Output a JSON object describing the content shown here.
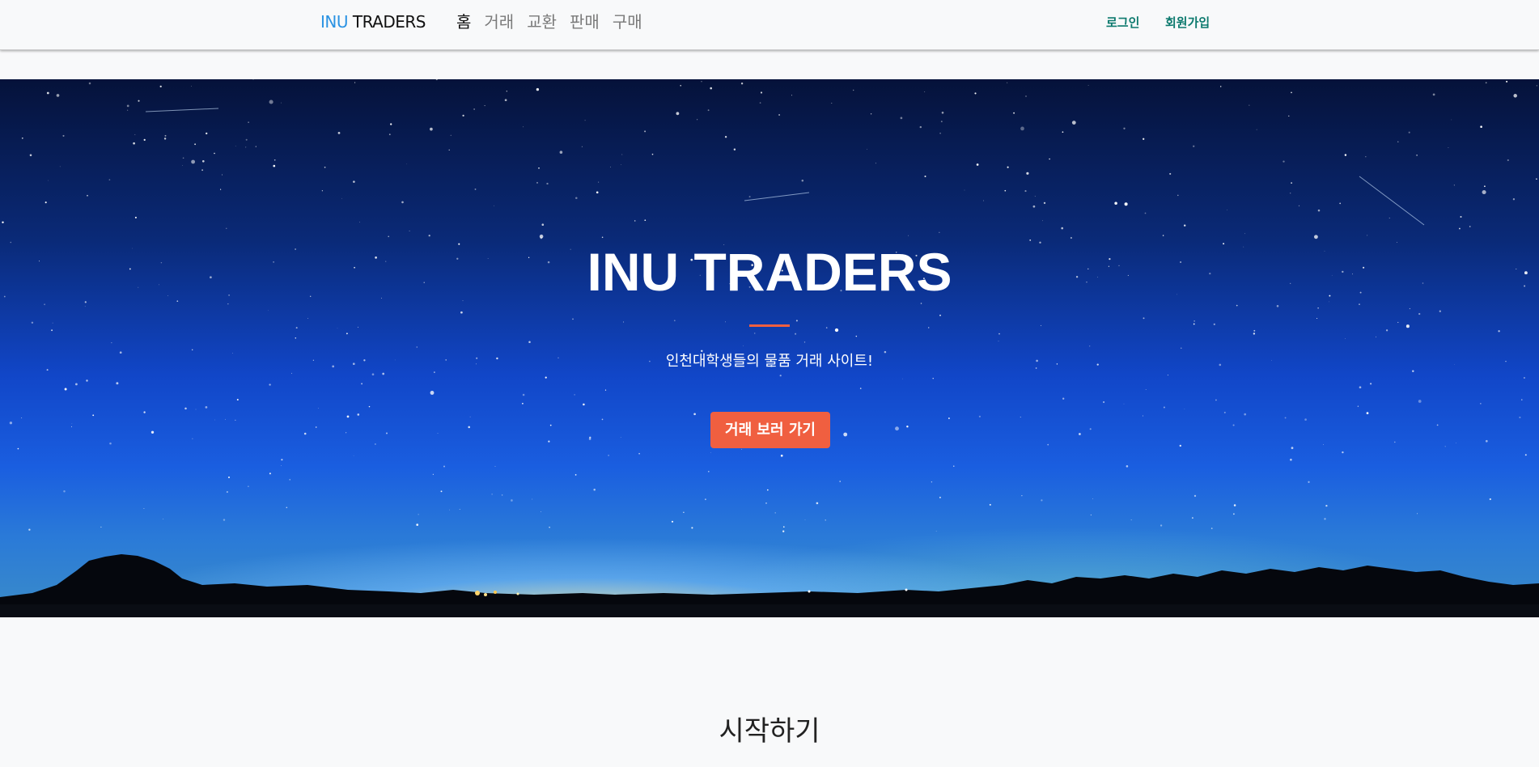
{
  "navbar": {
    "brand_accent": "INU",
    "brand_rest": " TRADERS",
    "links": [
      "홈",
      "거래",
      "교환",
      "판매",
      "구매"
    ],
    "active_link": "홈",
    "login": "로그인",
    "signup": "회원가입"
  },
  "hero": {
    "title": "INU TRADERS",
    "subtitle": "인천대학생들의 물품 거래 사이트!",
    "button": "거래 보러 가기",
    "background_image": "starry-night-sky"
  },
  "section": {
    "title": "시작하기"
  },
  "colors": {
    "brand_accent": "#2b93e3",
    "primary": "#f05f40",
    "nav_right": "#0d7a6e",
    "page_bg": "#f8f9fa"
  }
}
